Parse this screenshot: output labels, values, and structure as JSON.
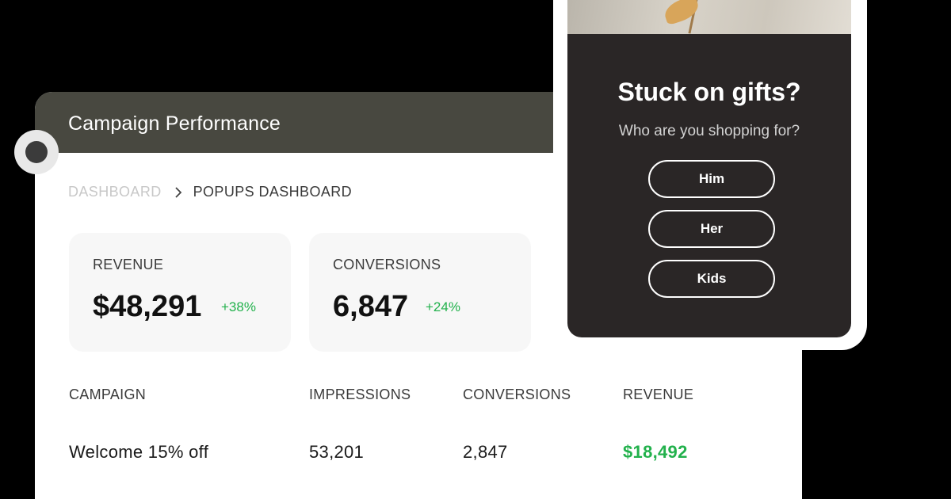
{
  "dashboard": {
    "title": "Campaign Performance",
    "breadcrumb": [
      "DASHBOARD",
      "POPUPS DASHBOARD"
    ],
    "stats": [
      {
        "label": "REVENUE",
        "value": "$48,291",
        "delta": "+38%"
      },
      {
        "label": "CONVERSIONS",
        "value": "6,847",
        "delta": "+24%"
      }
    ],
    "table": {
      "headers": [
        "CAMPAIGN",
        "IMPRESSIONS",
        "CONVERSIONS",
        "REVENUE"
      ],
      "rows": [
        [
          "Welcome 15% off",
          "53,201",
          "2,847",
          "$18,492"
        ]
      ]
    }
  },
  "popup": {
    "title": "Stuck on gifts?",
    "subtitle": "Who are you shopping for?",
    "options": [
      "Him",
      "Her",
      "Kids"
    ]
  },
  "colors": {
    "header": "#484840",
    "positive": "#22b14c",
    "popup_bg": "#2a2626"
  }
}
